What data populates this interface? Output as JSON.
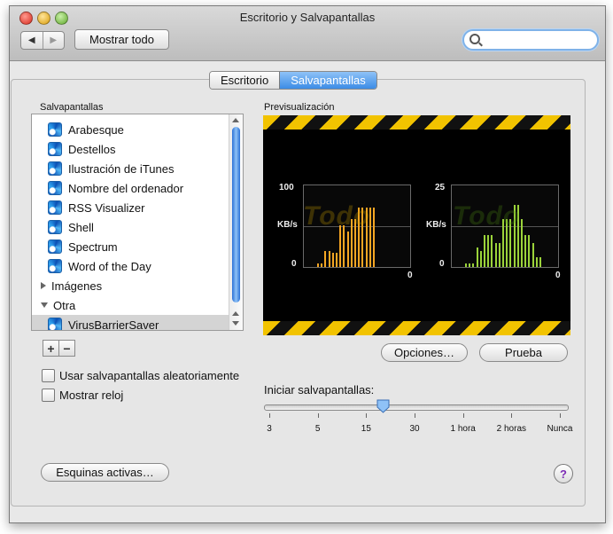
{
  "window": {
    "title": "Escritorio y Salvapantallas"
  },
  "toolbar": {
    "back_glyph": "◀",
    "forward_glyph": "▶",
    "show_all_label": "Mostrar todo",
    "search_placeholder": ""
  },
  "tabs": [
    {
      "label": "Escritorio",
      "selected": false
    },
    {
      "label": "Salvapantallas",
      "selected": true
    }
  ],
  "screensavers": {
    "heading": "Salvapantallas",
    "items": [
      {
        "label": "Arabesque",
        "type": "screensaver"
      },
      {
        "label": "Destellos",
        "type": "screensaver"
      },
      {
        "label": "Ilustración de iTunes",
        "type": "screensaver"
      },
      {
        "label": "Nombre del ordenador",
        "type": "screensaver"
      },
      {
        "label": "RSS Visualizer",
        "type": "screensaver"
      },
      {
        "label": "Shell",
        "type": "screensaver"
      },
      {
        "label": "Spectrum",
        "type": "screensaver"
      },
      {
        "label": "Word of the Day",
        "type": "screensaver"
      },
      {
        "label": "Imágenes",
        "type": "group",
        "expanded": false
      },
      {
        "label": "Otra",
        "type": "group",
        "expanded": true
      },
      {
        "label": "VirusBarrierSaver",
        "type": "screensaver",
        "selected": true
      }
    ],
    "add_label": "+",
    "remove_label": "−"
  },
  "options": {
    "random_label": "Usar salvapantallas aleatoriamente",
    "random_checked": false,
    "clock_label": "Mostrar reloj",
    "clock_checked": false
  },
  "preview": {
    "heading": "Previsualización",
    "left_graph": {
      "max": "100",
      "unit": "KB/s",
      "min": "0",
      "zero": "0",
      "color": "#f5a623",
      "watermark": "Todo",
      "watermark_color": "#c8a000",
      "bars": [
        5,
        5,
        20,
        20,
        18,
        18,
        52,
        52,
        45,
        60,
        60,
        75,
        75,
        75,
        75,
        75
      ]
    },
    "right_graph": {
      "max": "25",
      "unit": "KB/s",
      "min": "0",
      "zero": "0",
      "color": "#9bd33a",
      "watermark": "Todo",
      "watermark_color": "#4c8a12",
      "bars": [
        5,
        5,
        5,
        25,
        20,
        40,
        40,
        40,
        30,
        30,
        60,
        60,
        60,
        78,
        78,
        60,
        40,
        40,
        30,
        12,
        12
      ]
    }
  },
  "buttons": {
    "options_label": "Opciones…",
    "test_label": "Prueba",
    "hot_corners_label": "Esquinas activas…",
    "help_glyph": "?"
  },
  "start": {
    "label": "Iniciar salvapantallas:",
    "ticks": [
      "3",
      "5",
      "15",
      "30",
      "1 hora",
      "2 horas",
      "Nunca"
    ],
    "value_minutes": 20
  }
}
